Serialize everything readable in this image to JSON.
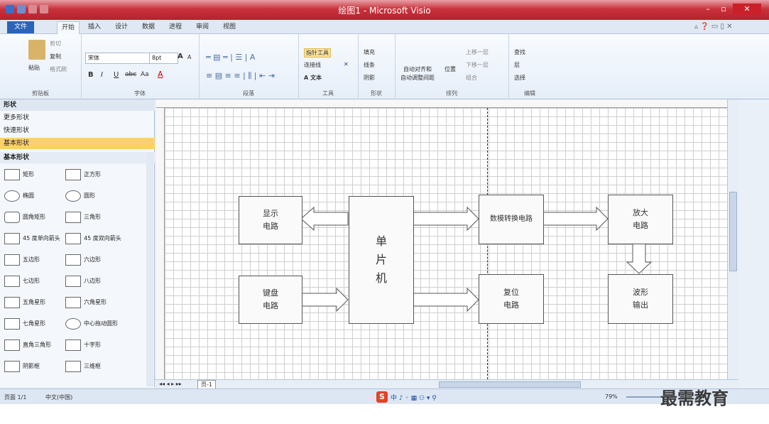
{
  "window": {
    "title": "绘图1 - Microsoft Visio",
    "controls": [
      "minimize-icon",
      "restore-icon",
      "close-icon"
    ]
  },
  "tabs": [
    {
      "label": "文件"
    },
    {
      "label": "开始"
    },
    {
      "label": "插入"
    },
    {
      "label": "设计"
    },
    {
      "label": "数据"
    },
    {
      "label": "进程"
    },
    {
      "label": "审阅"
    },
    {
      "label": "视图"
    }
  ],
  "active_tab": "开始",
  "ribbon": {
    "clipboard": {
      "paste": "粘贴",
      "cut": "剪切",
      "copy": "复制",
      "format_painter": "格式刷",
      "group": "剪贴板"
    },
    "font": {
      "name": "宋体",
      "size": "8pt",
      "bold": "B",
      "italic": "I",
      "underline": "U",
      "strike": "abc",
      "case": "Aa",
      "grow": "A",
      "shrink": "A",
      "color": "A",
      "group": "字体"
    },
    "paragraph": {
      "group": "段落"
    },
    "tools": {
      "pointer": "指针工具",
      "connector": "连接线",
      "text": "A 文本",
      "group": "工具"
    },
    "shape_style": {
      "fill": "填充",
      "line": "线条",
      "shadow": "阴影",
      "group": "形状"
    },
    "arrange": {
      "auto_align": "自动对齐和",
      "auto_space": "自动调整间距",
      "position": "位置",
      "bring_forward": "上移一层",
      "send_backward": "下移一层",
      "group_label": "组合",
      "group": "排列"
    },
    "editing": {
      "find": "查找",
      "layers": "层",
      "select": "选择",
      "group": "编辑"
    }
  },
  "shapes_panel": {
    "title": "形状",
    "more": "更多形状",
    "quick": "快速形状",
    "basic": "基本形状",
    "section": "基本形状",
    "items": [
      {
        "label": "矩形",
        "icon": "rectangle-icon"
      },
      {
        "label": "正方形",
        "icon": "square-icon"
      },
      {
        "label": "椭圆",
        "icon": "ellipse-icon"
      },
      {
        "label": "圆形",
        "icon": "circle-icon"
      },
      {
        "label": "圆角矩形",
        "icon": "rounded-rectangle-icon"
      },
      {
        "label": "三角形",
        "icon": "triangle-icon"
      },
      {
        "label": "45 度单向箭头",
        "icon": "single-arrow-icon"
      },
      {
        "label": "45 度双向箭头",
        "icon": "double-arrow-icon"
      },
      {
        "label": "五边形",
        "icon": "pentagon-icon"
      },
      {
        "label": "六边形",
        "icon": "hexagon-icon"
      },
      {
        "label": "七边形",
        "icon": "heptagon-icon"
      },
      {
        "label": "八边形",
        "icon": "octagon-icon"
      },
      {
        "label": "五角星形",
        "icon": "star5-icon"
      },
      {
        "label": "六角星形",
        "icon": "star6-icon"
      },
      {
        "label": "七角星形",
        "icon": "star7-icon"
      },
      {
        "label": "中心拖动圆形",
        "icon": "center-circle-icon"
      },
      {
        "label": "直角三角形",
        "icon": "right-triangle-icon"
      },
      {
        "label": "十字形",
        "icon": "cross-icon"
      },
      {
        "label": "阴影框",
        "icon": "shadow-box-icon"
      },
      {
        "label": "三维框",
        "icon": "3d-box-icon"
      }
    ]
  },
  "diagram": {
    "blocks": {
      "display": "显示\n电路",
      "mcu": "单\n片\n机",
      "dac": "数模转换电路",
      "amp": "放大\n电路",
      "keyboard": "键盘\n电路",
      "reset": "复位\n电路",
      "wave": "波形\n输出"
    }
  },
  "page_tabs": {
    "page": "页-1"
  },
  "status": {
    "page": "页面 1/1",
    "lang": "中文(中国)",
    "zoom": "79%"
  },
  "watermark": "最需教育"
}
